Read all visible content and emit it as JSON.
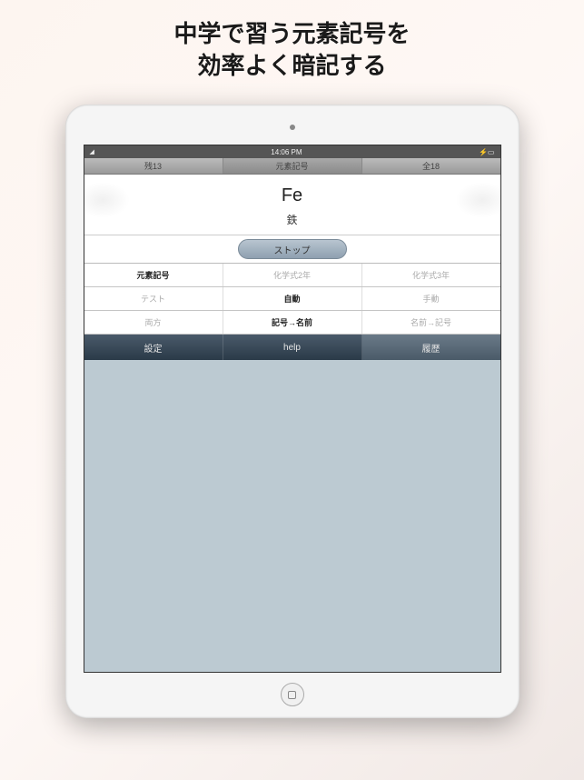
{
  "promo": {
    "line1": "中学で習う元素記号を",
    "line2": "効率よく暗記する"
  },
  "statusBar": {
    "time": "14:06 PM"
  },
  "topInfo": {
    "remaining": "残13",
    "title": "元素記号",
    "total": "全18"
  },
  "card": {
    "symbol": "Fe",
    "name": "鉄"
  },
  "actions": {
    "stopLabel": "ストップ"
  },
  "options": {
    "row1": [
      {
        "label": "元素記号",
        "active": true
      },
      {
        "label": "化学式2年",
        "active": false
      },
      {
        "label": "化学式3年",
        "active": false
      }
    ],
    "row2": [
      {
        "label": "テスト",
        "active": false
      },
      {
        "label": "自動",
        "active": true
      },
      {
        "label": "手動",
        "active": false
      }
    ],
    "row3": [
      {
        "label": "両方",
        "active": false
      },
      {
        "label": "記号→名前",
        "active": true
      },
      {
        "label": "名前→記号",
        "active": false
      }
    ]
  },
  "bottomBar": {
    "items": [
      {
        "label": "設定",
        "selected": false
      },
      {
        "label": "help",
        "selected": false
      },
      {
        "label": "履歴",
        "selected": true
      }
    ]
  }
}
